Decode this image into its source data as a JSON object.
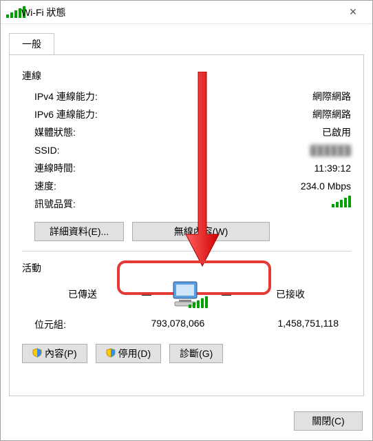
{
  "window": {
    "title": "Wi-Fi 狀態",
    "close_label": "×"
  },
  "tab_general": "一般",
  "section_connection": "連線",
  "rows": {
    "ipv4_label": "IPv4 連線能力:",
    "ipv4_value": "網際網路",
    "ipv6_label": "IPv6 連線能力:",
    "ipv6_value": "網際網路",
    "media_label": "媒體狀態:",
    "media_value": "已啟用",
    "ssid_label": "SSID:",
    "ssid_value": "██████",
    "dur_label": "連線時間:",
    "dur_value": "11:39:12",
    "speed_label": "速度:",
    "speed_value": "234.0 Mbps",
    "signal_label": "訊號品質:"
  },
  "details_btn": "詳細資料(E)...",
  "wireless_btn": "無線內容(W)",
  "section_activity": "活動",
  "activity": {
    "sent_label": "已傳送",
    "recv_label": "已接收",
    "bytes_label": "位元組:",
    "sent_value": "793,078,066",
    "recv_value": "1,458,751,118"
  },
  "props_btn": "內容(P)",
  "disable_btn": "停用(D)",
  "diagnose_btn": "診斷(G)",
  "close_btn": "關閉(C)"
}
